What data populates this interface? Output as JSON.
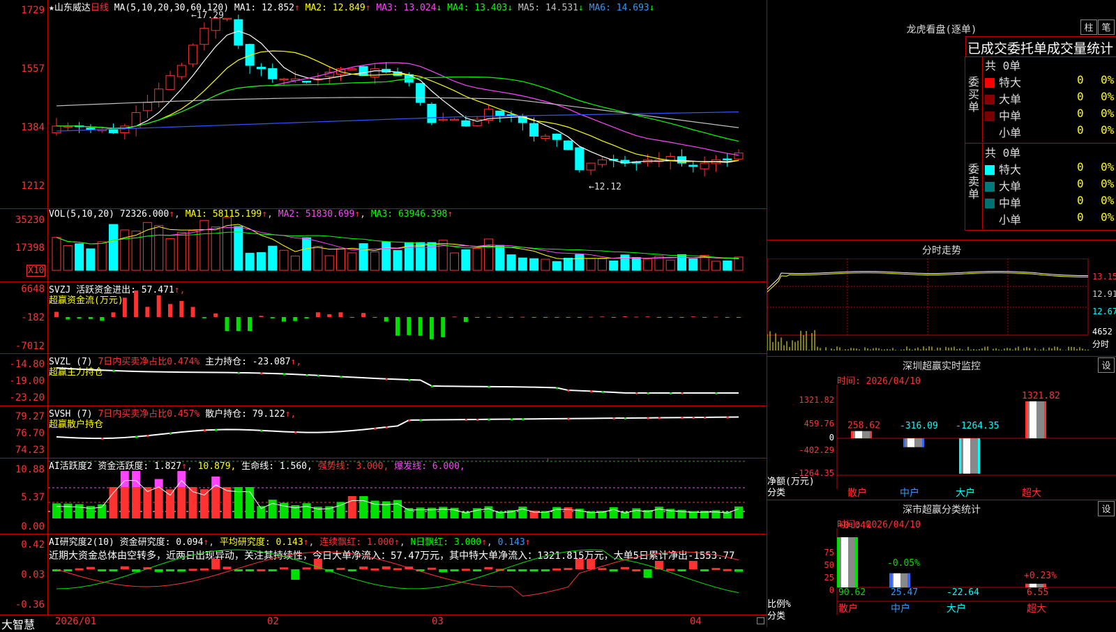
{
  "stock": {
    "star": "★",
    "name": "山东威达",
    "period": "日线"
  },
  "main": {
    "ma_label": "MA(5,10,20,30,60,120)",
    "ma1": "MA1: 12.852",
    "ma1_arrow": "↑",
    "ma2": "MA2: 12.849",
    "ma2_arrow": "↑",
    "ma3": "MA3: 13.024",
    "ma3_arrow": "↓",
    "ma4": "MA4: 13.403",
    "ma4_arrow": "↓",
    "ma5": "MA5: 14.531",
    "ma5_arrow": "↓",
    "ma6": "MA6: 14.693",
    "ma6_arrow": "↓",
    "yticks": [
      "1729",
      "1557",
      "1384",
      "1212"
    ],
    "high_mark": "17.29",
    "low_mark": "12.12",
    "colors": {
      "up": "#ff3232",
      "down": "#00ffff"
    }
  },
  "vol": {
    "label": "VOL(5,10,20)",
    "value": "72326.000",
    "value_arrow": "↑",
    "ma1": "MA1: 58115.199",
    "ma1_arrow": "↑",
    "ma2": "MA2: 51830.699",
    "ma2_arrow": "↑",
    "ma3": "MA3: 63946.398",
    "ma3_arrow": "↑",
    "yticks": [
      "35230",
      "17398"
    ],
    "unit": "X10"
  },
  "svzj": {
    "label": "SVZJ",
    "line1": "活跃资金进出: 57.471",
    "arrow": "↑,",
    "sub": "超赢资金流(万元)",
    "yticks": [
      "6648",
      "-182",
      "-7012"
    ]
  },
  "svzl": {
    "label": "SVZL (7)",
    "ratio": "7日内买卖净占比0.474%",
    "hold": "主力持仓: -23.087",
    "arrow": "↑,",
    "sub": "超赢主力持仓",
    "yticks": [
      "-14.80",
      "-19.00",
      "-23.20"
    ]
  },
  "svsh": {
    "label": "SVSH (7)",
    "ratio": "7日内买卖净占比0.457%",
    "hold": "散户持仓: 79.122",
    "arrow": "↑,",
    "sub": "超赢散户持仓",
    "yticks": [
      "79.27",
      "76.70",
      "74.23"
    ]
  },
  "ai1": {
    "label": "AI活跃度2",
    "act": "资金活跃度: 1.827",
    "v2": "10.879,",
    "life": "生命线: 1.560,",
    "strong": "强势线: 3.000,",
    "burst": "爆发线: 6.000,",
    "yticks": [
      "10.88",
      "5.37",
      "0.00"
    ]
  },
  "ai2": {
    "label": "AI研究度2(10)",
    "res": "资金研究度: 0.094",
    "avg": "平均研究度: 0.143",
    "cont": "连续飘红: 1.000",
    "nday": "N日飘红: 3.000",
    "last": "0.143",
    "comment": "近期大资金总体由空转多，近两日出现异动，关注其持续性，今日大单净流入：57.47万元，其中特大单净流入：1321.815万元，大单5日累计净出-1553.77",
    "yticks": [
      "0.42",
      "0.03",
      "-0.36"
    ]
  },
  "xaxis": {
    "brand": "大智慧",
    "labels": [
      "2026/01",
      "02",
      "03",
      "04"
    ]
  },
  "longhu": {
    "title": "龙虎看盘(逐单)",
    "btn_bar": "柱",
    "btn_pen": "笔",
    "subtitle": "已成交委托单成交量统计",
    "buy_side": "委买单",
    "sell_side": "委卖单",
    "buy_total": "共 0单",
    "sell_total": "共 0单",
    "buy_rows": [
      {
        "name": "特大",
        "n": "0",
        "p": "0%"
      },
      {
        "name": "大单",
        "n": "0",
        "p": "0%"
      },
      {
        "name": "中单",
        "n": "0",
        "p": "0%"
      },
      {
        "name": "小单",
        "n": "0",
        "p": "0%"
      }
    ],
    "sell_rows": [
      {
        "name": "特大",
        "n": "0",
        "p": "0%"
      },
      {
        "name": "大单",
        "n": "0",
        "p": "0%"
      },
      {
        "name": "中单",
        "n": "0",
        "p": "0%"
      },
      {
        "name": "小单",
        "n": "0",
        "p": "0%"
      }
    ]
  },
  "intraday": {
    "title": "分时走势",
    "yticks": [
      "13.15",
      "12.91",
      "12.67",
      "4652"
    ],
    "vol_unit": "分时"
  },
  "monitor": {
    "title": "深圳超赢实时监控",
    "btn": "设",
    "time": "时间: 2026/04/10",
    "yticks": [
      "1321.82",
      "459.76",
      "0",
      "-402.29",
      "-1264.35"
    ],
    "ylab1": "净额(万元)",
    "ylab2": "分类",
    "cats": [
      "散户",
      "中户",
      "大户",
      "超大"
    ],
    "vals": [
      "258.62",
      "-316.09",
      "-1264.35",
      "1321.82"
    ]
  },
  "classify": {
    "title": "深市超赢分类统计",
    "btn": "设",
    "time": "时间: 2026/04/10",
    "yticks": [
      "75",
      "50",
      "25",
      "0"
    ],
    "ylab1": "比例%",
    "ylab2": "分类",
    "cats": [
      "散户",
      "中户",
      "大户",
      "超大"
    ],
    "pcts": [
      "+0.04%",
      "-0.05%",
      "+0.23%"
    ],
    "vals": [
      "90.62",
      "25.47",
      "-22.64",
      "6.55"
    ]
  }
}
